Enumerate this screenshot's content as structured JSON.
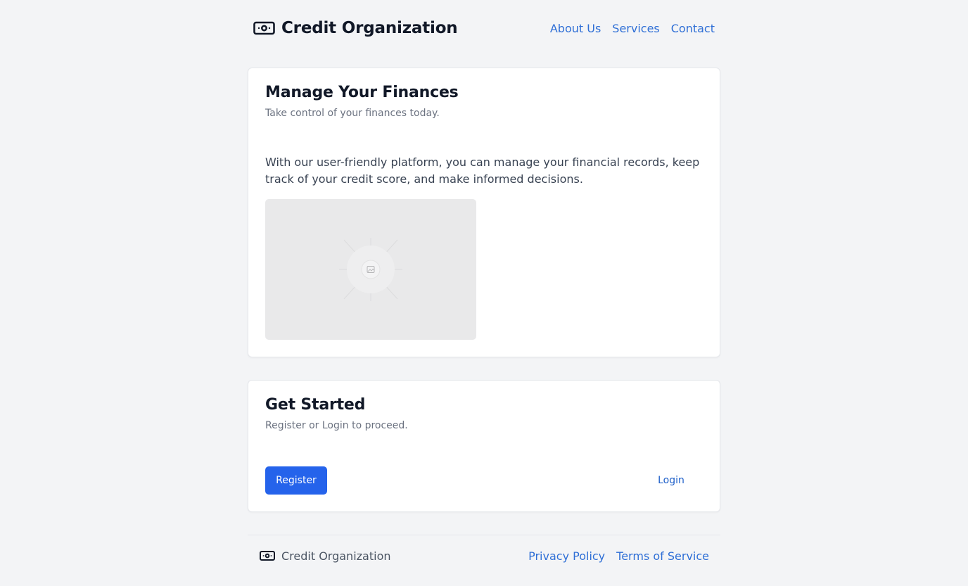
{
  "header": {
    "brand_icon": "banknote-icon",
    "brand_title": "Credit Organization",
    "nav": [
      {
        "label": "About Us"
      },
      {
        "label": "Services"
      },
      {
        "label": "Contact"
      }
    ]
  },
  "finances_card": {
    "title": "Manage Your Finances",
    "subtitle": "Take control of your finances today.",
    "description": "With our user-friendly platform, you can manage your financial records, keep track of your credit score, and make informed decisions.",
    "image_icon": "image-placeholder-icon"
  },
  "get_started_card": {
    "title": "Get Started",
    "subtitle": "Register or Login to proceed.",
    "register_label": "Register",
    "login_label": "Login"
  },
  "footer": {
    "brand_icon": "banknote-icon",
    "brand_title": "Credit Organization",
    "links": [
      {
        "label": "Privacy Policy"
      },
      {
        "label": "Terms of Service"
      }
    ]
  },
  "colors": {
    "background": "#f3f4f6",
    "card": "#ffffff",
    "link": "#2f6fd6",
    "primary_button": "#2563eb",
    "heading": "#111827",
    "muted": "#6b7280"
  }
}
